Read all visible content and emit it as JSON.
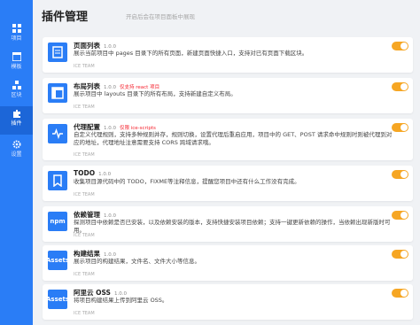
{
  "sidebar": {
    "items": [
      {
        "label": "项目",
        "icon": "dashboard-icon"
      },
      {
        "label": "模板",
        "icon": "template-icon"
      },
      {
        "label": "区块",
        "icon": "blocks-icon"
      },
      {
        "label": "插件",
        "icon": "plugin-icon"
      },
      {
        "label": "设置",
        "icon": "gear-icon"
      }
    ],
    "active_index": 3
  },
  "header": {
    "title": "插件管理",
    "subtitle": "开启后会在项目面板中展现"
  },
  "plugins": [
    {
      "name": "页面列表",
      "version": "1.0.0",
      "tag": "",
      "description": "展示当前项目中 pages 目录下的所有页面，新建页面快捷入口，支持对已有页面下载区块。",
      "author": "ICE TEAM",
      "enabled": true,
      "icon": "page-list-icon",
      "icon_text": ""
    },
    {
      "name": "布局列表",
      "version": "1.0.0",
      "tag": "仅支持 react 项目",
      "description": "展示项目中 layouts 目录下的所有布局，支持新建自定义布局。",
      "author": "ICE TEAM",
      "enabled": true,
      "icon": "layout-list-icon",
      "icon_text": ""
    },
    {
      "name": "代理配置",
      "version": "1.0.0",
      "tag": "仅限 ice-scripts",
      "description": "自定义代理规则，支持多种规则并存，规则切换，设置代理后重启应用，项目中的 GET、POST 请求命中规则时则被代理到对应的地址，代理地址注意需要支持 CORS 跨域请求哦。",
      "author": "ICE TEAM",
      "enabled": true,
      "icon": "proxy-icon",
      "icon_text": ""
    },
    {
      "name": "TODO",
      "version": "1.0.0",
      "tag": "",
      "description": "收集项目源代码中的 TODO，FIXME等注释信息，提醒您项目中还有什么工作没有完成。",
      "author": "ICE TEAM",
      "enabled": true,
      "icon": "bookmark-icon",
      "icon_text": ""
    },
    {
      "name": "依赖管理",
      "version": "1.0.0",
      "tag": "",
      "description": "探测项目中依赖是否已安装，以及依赖安装的版本，支持快捷安装项目依赖；支持一键更新依赖的操作，当依赖出现新版时可用。",
      "author": "ICE TEAM",
      "enabled": true,
      "icon": "npm-icon",
      "icon_text": "npm"
    },
    {
      "name": "构建结果",
      "version": "1.0.0",
      "tag": "",
      "description": "展示项目的构建结果，文件名、文件大小等信息。",
      "author": "ICE TEAM",
      "enabled": true,
      "icon": "assets-icon",
      "icon_text": "Assets"
    },
    {
      "name": "阿里云 OSS",
      "version": "1.0.0",
      "tag": "",
      "description": "将项目构建结果上传到阿里云 OSS。",
      "author": "ICE TEAM",
      "enabled": true,
      "icon": "oss-assets-icon",
      "icon_text": "Assets"
    }
  ],
  "colors": {
    "primary": "#2a7df6",
    "toggle_on": "#f6a623",
    "tag": "#f5222d"
  }
}
